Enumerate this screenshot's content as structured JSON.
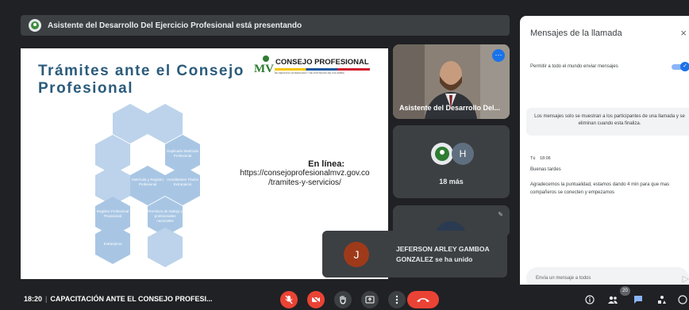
{
  "presenting": {
    "text": "Asistente del Desarrollo Del Ejercicio Profesional está presentando"
  },
  "slide": {
    "title_line1": "Trámites ante el Consejo",
    "title_line2": "Profesional",
    "logo_letters": "MVZ",
    "logo_text": "CONSEJO PROFESIONAL",
    "logo_subtext": "DE MEDICINA VETERINARIA Y DE ZOOTECNIA DE COLOMBIA",
    "hexagons": [
      {
        "label": "Duplicado Matrícula Profesional"
      },
      {
        "label": "Matrícula y Registro Profesional"
      },
      {
        "label": "Acreditantes Títulos Extranjeros"
      },
      {
        "label": "Registro Profesional Provisional"
      },
      {
        "label": "Permisos de trabajo y profesionales nacionales"
      },
      {
        "label": "Extranjeros"
      }
    ],
    "online_heading": "En línea:",
    "online_url_line1": "https://consejoprofesionalmvz.gov.co",
    "online_url_line2": "/tramites-y-servicios/"
  },
  "tiles": {
    "presenter_name": "Asistente del Desarrollo Del...",
    "more_avatar_letter": "H",
    "more_count": "18 más"
  },
  "toast": {
    "initial": "J",
    "message_line1": "JEFERSON ARLEY GAMBOA",
    "message_line2": "GONZALEZ se ha unido"
  },
  "chat": {
    "title": "Mensajes de la llamada",
    "close_glyph": "×",
    "permission_label": "Permitir a todo el mundo enviar mensajes",
    "permission_on": true,
    "notice": "Los mensajes solo se muestran a los participantes de una llamada y se eliminan cuando esta finaliza.",
    "message_sender": "Tú",
    "message_time": "18:06",
    "message_1": "Buenas tardes",
    "message_2": "Agradecemos la puntualidad, estamos dando 4 min para que mas compañeros se conecten y empezamos",
    "input_placeholder": "Envía un mensaje a todos"
  },
  "bottom_bar": {
    "time": "18:20",
    "meeting_title": "CAPACITACIÓN ANTE EL CONSEJO PROFESI...",
    "participants_badge": "20"
  },
  "colors": {
    "background": "#202124",
    "tile": "#3c4043",
    "accent": "#1a73e8",
    "danger": "#ea4335",
    "slide_title": "#2b5b7b",
    "hexagon": "#bcd3eb"
  }
}
